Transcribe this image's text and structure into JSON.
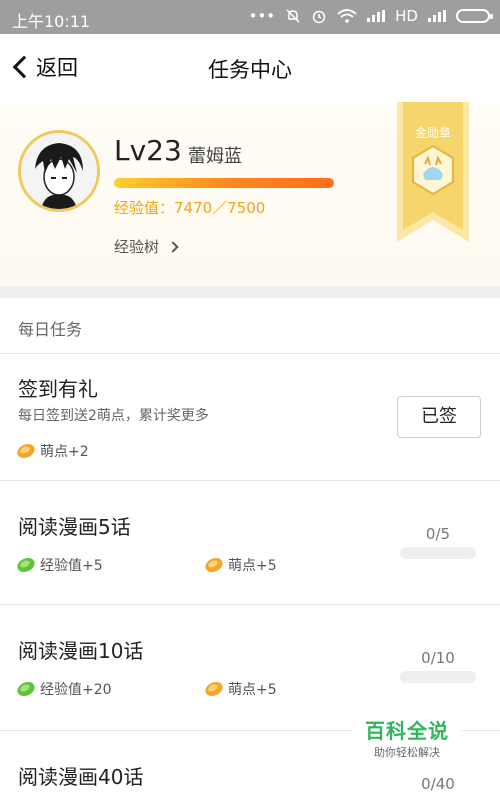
{
  "status_bar": {
    "time": "上午10:11",
    "network": "HD"
  },
  "nav": {
    "back_label": "返回",
    "title": "任务中心"
  },
  "profile": {
    "level": "Lv23",
    "nickname": "蕾姆蓝",
    "xp_text": "经验值：7470／7500",
    "xp_progress": 0.996,
    "exp_tree_label": "经验树",
    "medal_label": "金勋章"
  },
  "section": {
    "title": "每日任务"
  },
  "tasks": [
    {
      "title": "签到有礼",
      "desc": "每日签到送2萌点，累计奖更多",
      "reward_points": "萌点+2",
      "button_label": "已签"
    },
    {
      "title": "阅读漫画5话",
      "reward_xp": "经验值+5",
      "reward_points": "萌点+5",
      "progress_text": "0/5",
      "progress": 0
    },
    {
      "title": "阅读漫画10话",
      "reward_xp": "经验值+20",
      "reward_points": "萌点+5",
      "progress_text": "0/10",
      "progress": 0
    },
    {
      "title": "阅读漫画40话",
      "progress_text": "0/40",
      "progress": 0
    }
  ],
  "watermark": {
    "title": "百科全说",
    "subtitle": "助你轻松解决"
  },
  "colors": {
    "accent_orange": "#ff7a1a",
    "xp_text": "#f3a316",
    "xp_green": "#5cc53a",
    "points_orange": "#f4a62a",
    "medal_gold": "#f5c242"
  }
}
